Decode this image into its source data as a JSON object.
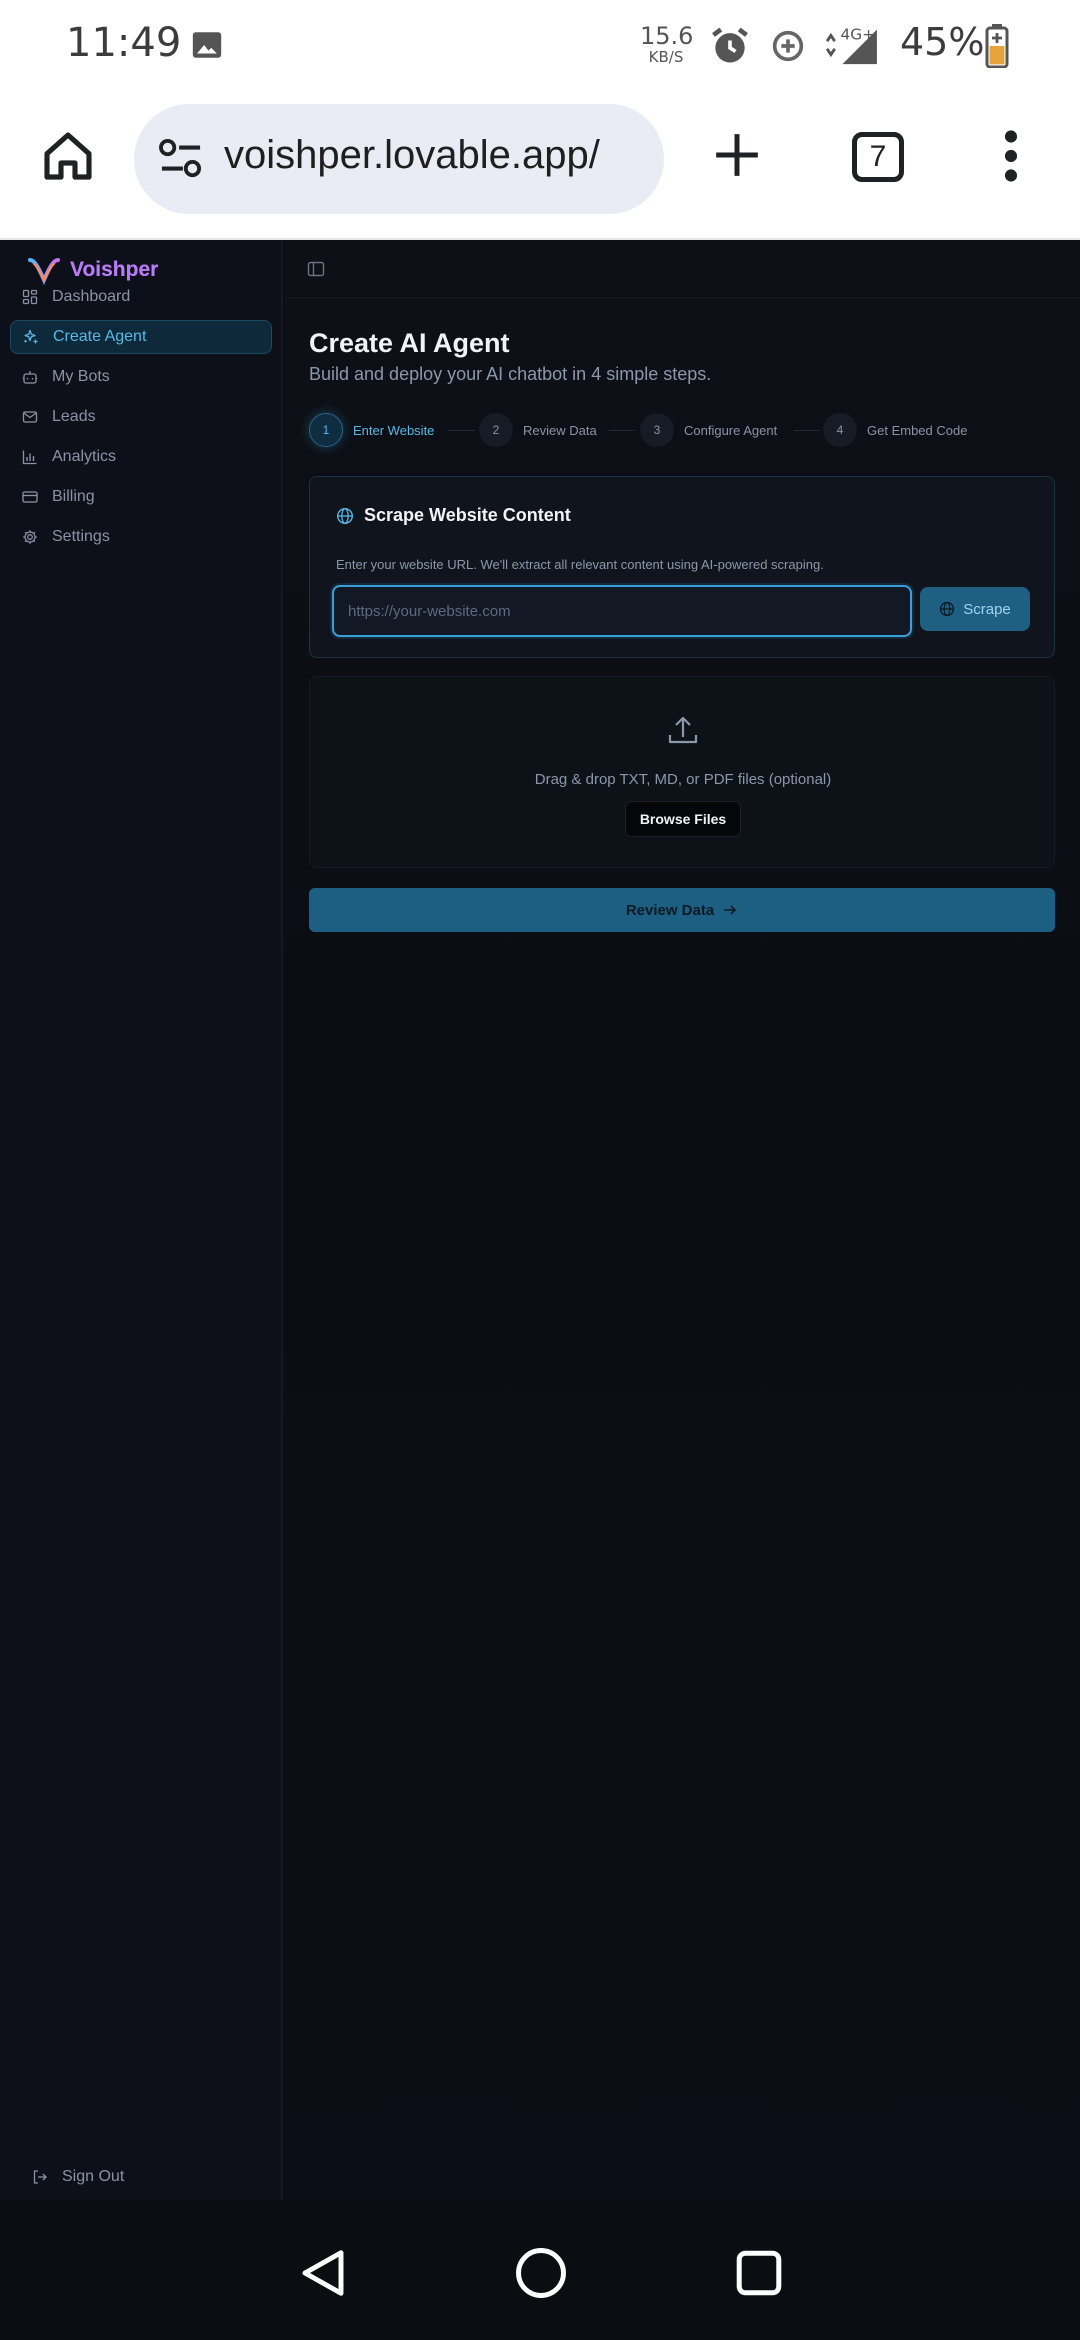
{
  "status_bar": {
    "time": "11:49",
    "speed_value": "15.6",
    "speed_unit": "KB/S",
    "network": "4G+",
    "battery": "45%"
  },
  "browser": {
    "url": "voishper.lovable.app/",
    "tab_count": "7"
  },
  "brand": {
    "name": "Voishper"
  },
  "sidebar": {
    "items": [
      {
        "label": "Dashboard",
        "icon": "dashboard-icon"
      },
      {
        "label": "Create Agent",
        "icon": "sparkle-icon",
        "active": true
      },
      {
        "label": "My Bots",
        "icon": "bot-icon"
      },
      {
        "label": "Leads",
        "icon": "mail-icon"
      },
      {
        "label": "Analytics",
        "icon": "bar-chart-icon"
      },
      {
        "label": "Billing",
        "icon": "credit-card-icon"
      },
      {
        "label": "Settings",
        "icon": "gear-icon"
      }
    ],
    "sign_out": "Sign Out"
  },
  "page": {
    "title": "Create AI Agent",
    "subtitle": "Build and deploy your AI chatbot in 4 simple steps."
  },
  "steps": [
    {
      "num": "1",
      "label": "Enter Website",
      "active": true
    },
    {
      "num": "2",
      "label": "Review Data"
    },
    {
      "num": "3",
      "label": "Configure Agent"
    },
    {
      "num": "4",
      "label": "Get Embed Code"
    }
  ],
  "scrape": {
    "title": "Scrape Website Content",
    "description": "Enter your website URL. We'll extract all relevant content using AI-powered scraping.",
    "placeholder": "https://your-website.com",
    "button": "Scrape"
  },
  "upload": {
    "text": "Drag & drop TXT, MD, or PDF files (optional)",
    "button": "Browse Files"
  },
  "review_button": "Review Data",
  "colors": {
    "accent": "#3aa0d8",
    "brand_gradient_start": "#a977ff",
    "brand_gradient_end": "#d57bf4",
    "background": "#0b0d12"
  }
}
